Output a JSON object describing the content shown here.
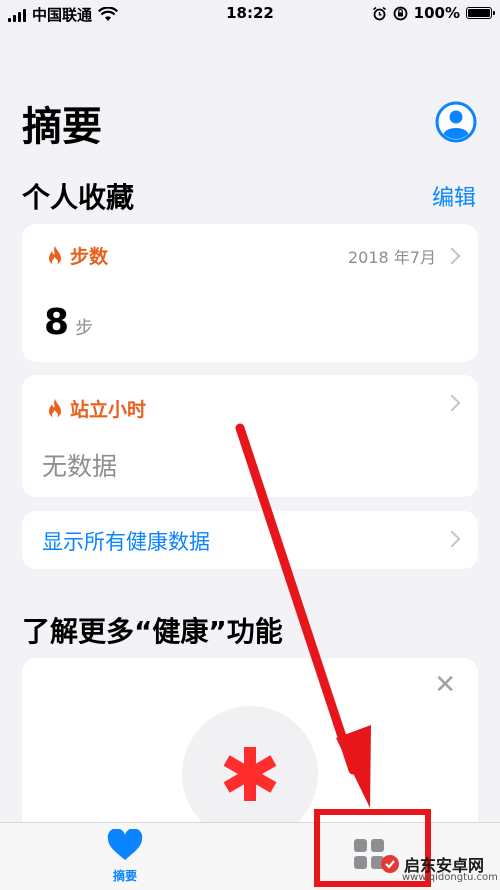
{
  "status_bar": {
    "carrier": "中国联通",
    "time": "18:22",
    "battery": "100%",
    "battery_level": 1.0
  },
  "header": {
    "title": "摘要",
    "avatar_icon": "person-circle-icon"
  },
  "favorites": {
    "title": "个人收藏",
    "edit_label": "编辑",
    "steps_card": {
      "label": "步数",
      "date": "2018 年7月",
      "value": "8",
      "unit": "步",
      "icon": "flame-icon"
    },
    "stand_card": {
      "label": "站立小时",
      "value": "无数据",
      "icon": "flame-icon"
    },
    "show_all_label": "显示所有健康数据"
  },
  "learn_more": {
    "title": "了解更多“健康”功能",
    "close_label": "✕",
    "icon": "health-asterisk-icon"
  },
  "tab_bar": {
    "summary_label": "摘要",
    "summary_icon": "heart-icon",
    "browse_icon": "grid-icon"
  },
  "watermark": {
    "name": "启东安卓网",
    "url": "www.qidongtu.com"
  },
  "colors": {
    "accent": "#0a84ff",
    "activity": "#e8601c",
    "annotation": "#e6161b"
  }
}
